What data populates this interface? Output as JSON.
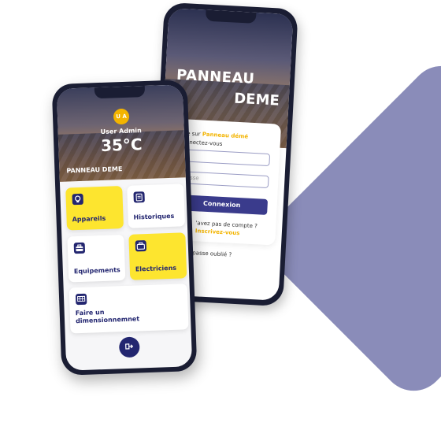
{
  "login": {
    "header_line1": "PANNEAU",
    "header_line2": "DEME",
    "welcome_prefix": "nue sur",
    "welcome_brand": "Panneau démé",
    "welcome_line2": "connectez-vous",
    "password_placeholder": "passe",
    "submit_label": "Connexion",
    "no_account": "'avez pas de compte ?",
    "signup_link": "Inscrivez-vous",
    "forgot_link": "t de passe oublié ?"
  },
  "dashboard": {
    "avatar_initials": "U A",
    "user_name": "User Admin",
    "temperature": "35°C",
    "brand": "PANNEAU DEME",
    "tiles": [
      {
        "label": "Appareils",
        "icon": "lightbulb-icon",
        "highlight": true
      },
      {
        "label": "Historiques",
        "icon": "clipboard-icon",
        "highlight": false
      },
      {
        "label": "Equipements",
        "icon": "toolbox-icon",
        "highlight": false
      },
      {
        "label": "Electriciens",
        "icon": "toolbox-icon",
        "highlight": true
      },
      {
        "label": "Faire un dimensionnemnet",
        "icon": "solar-panel-icon",
        "highlight": false
      }
    ],
    "logout_icon": "logout-icon"
  },
  "colors": {
    "accent_yellow": "#fde52f",
    "primary_navy": "#232670",
    "shape_purple": "#8a8cb9",
    "highlight_orange": "#f3b400"
  }
}
